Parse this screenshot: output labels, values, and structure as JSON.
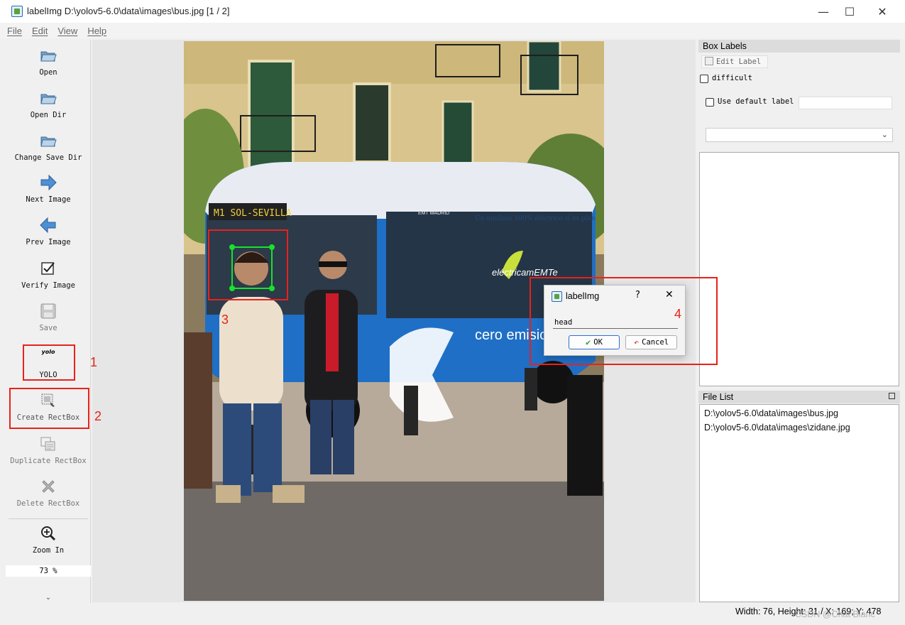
{
  "window": {
    "title": "labelImg D:\\yolov5-6.0\\data\\images\\bus.jpg [1 / 2]",
    "minimize_glyph": "—",
    "maximize_glyph": "☐",
    "close_glyph": "✕"
  },
  "menu": [
    "File",
    "Edit",
    "View",
    "Help"
  ],
  "toolbar": {
    "items": [
      {
        "label": "Open",
        "icon": "folder-open-icon"
      },
      {
        "label": "Open Dir",
        "icon": "folder-open-icon"
      },
      {
        "label": "Change Save Dir",
        "icon": "folder-open-icon"
      },
      {
        "label": "Next Image",
        "icon": "arrow-right-icon"
      },
      {
        "label": "Prev Image",
        "icon": "arrow-left-icon"
      },
      {
        "label": "Verify Image",
        "icon": "checkbox-icon"
      },
      {
        "label": "Save",
        "icon": "floppy-disk-icon"
      },
      {
        "label": "YOLO",
        "icon": "yolo-format-icon",
        "icon_text": "yolo"
      },
      {
        "label": "Create RectBox",
        "icon": "create-rectbox-icon"
      },
      {
        "label": "Duplicate RectBox",
        "icon": "duplicate-rectbox-icon"
      },
      {
        "label": "Delete RectBox",
        "icon": "delete-x-icon"
      },
      {
        "label": "Zoom In",
        "icon": "zoom-in-icon"
      }
    ],
    "zoom_value": "73 %",
    "more_glyph": "⌄"
  },
  "box_labels": {
    "title": "Box Labels",
    "edit_label_button": "Edit Label",
    "difficult_label": "difficult",
    "use_default_label": "Use default label",
    "default_label_value": "",
    "label_combo_value": ""
  },
  "file_list": {
    "title": "File List",
    "files": [
      "D:\\yolov5-6.0\\data\\images\\bus.jpg",
      "D:\\yolov5-6.0\\data\\images\\zidane.jpg"
    ]
  },
  "dialog": {
    "title": "labelImg",
    "help_glyph": "?",
    "close_glyph": "✕",
    "input_value": "head",
    "ok_label": "OK",
    "cancel_label": "Cancel"
  },
  "canvas": {
    "photo_text": {
      "route_sign": "M1 SOL-SEVILLA",
      "side_slogan": "Un minibús 100% eléctrico sí es plan",
      "brand": "eléctricamEMTe",
      "emission": "cero emisiones",
      "operator": "EMT MADRID"
    }
  },
  "status": {
    "text": "Width: 76, Height: 31 / X: 169; Y: 478"
  },
  "watermark": "CSDN @Chat Blanc",
  "annotations": [
    "1",
    "2",
    "3",
    "4"
  ],
  "colors": {
    "annotation_red": "#e8221a",
    "bounding_box_green": "#19e22a",
    "bus_blue": "#1f6fc6",
    "ok_border": "#2f6fd1"
  }
}
